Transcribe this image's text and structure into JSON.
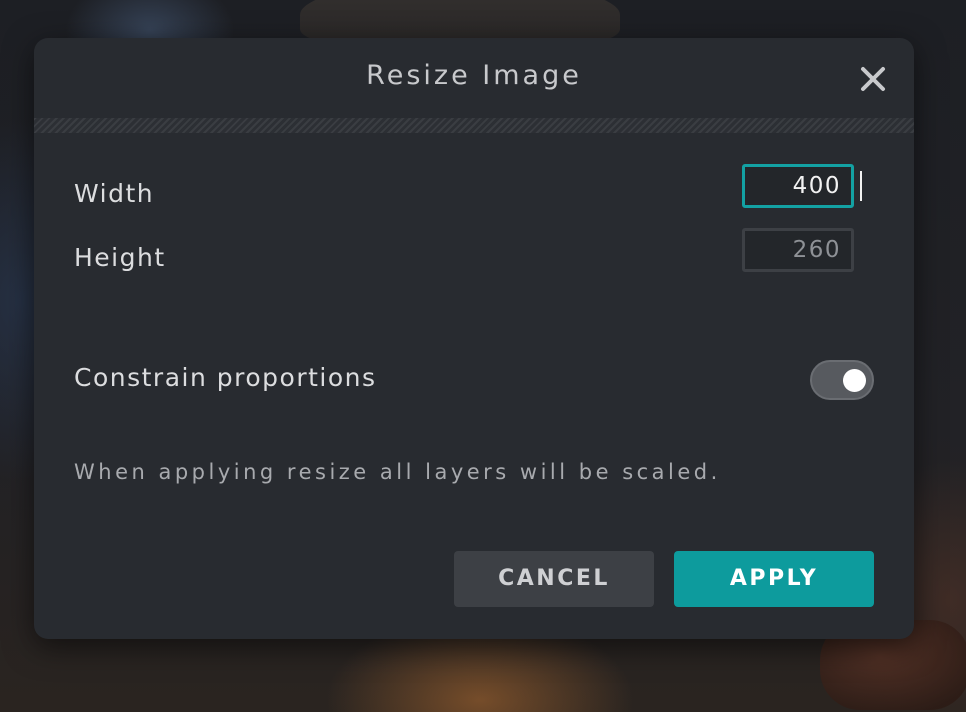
{
  "colors": {
    "accent": "#0d9b9d",
    "dialog_background": "#282b30",
    "input_active_border": "#13a1a3"
  },
  "dialog": {
    "title": "Resize Image",
    "close_icon": "close-icon",
    "width": {
      "label": "Width",
      "value": "400",
      "focused": true
    },
    "height": {
      "label": "Height",
      "value": "260",
      "focused": false
    },
    "constrain": {
      "label": "Constrain proportions",
      "enabled": true
    },
    "note": "When applying resize all layers will be scaled.",
    "buttons": {
      "cancel": "CANCEL",
      "apply": "APPLY"
    }
  }
}
